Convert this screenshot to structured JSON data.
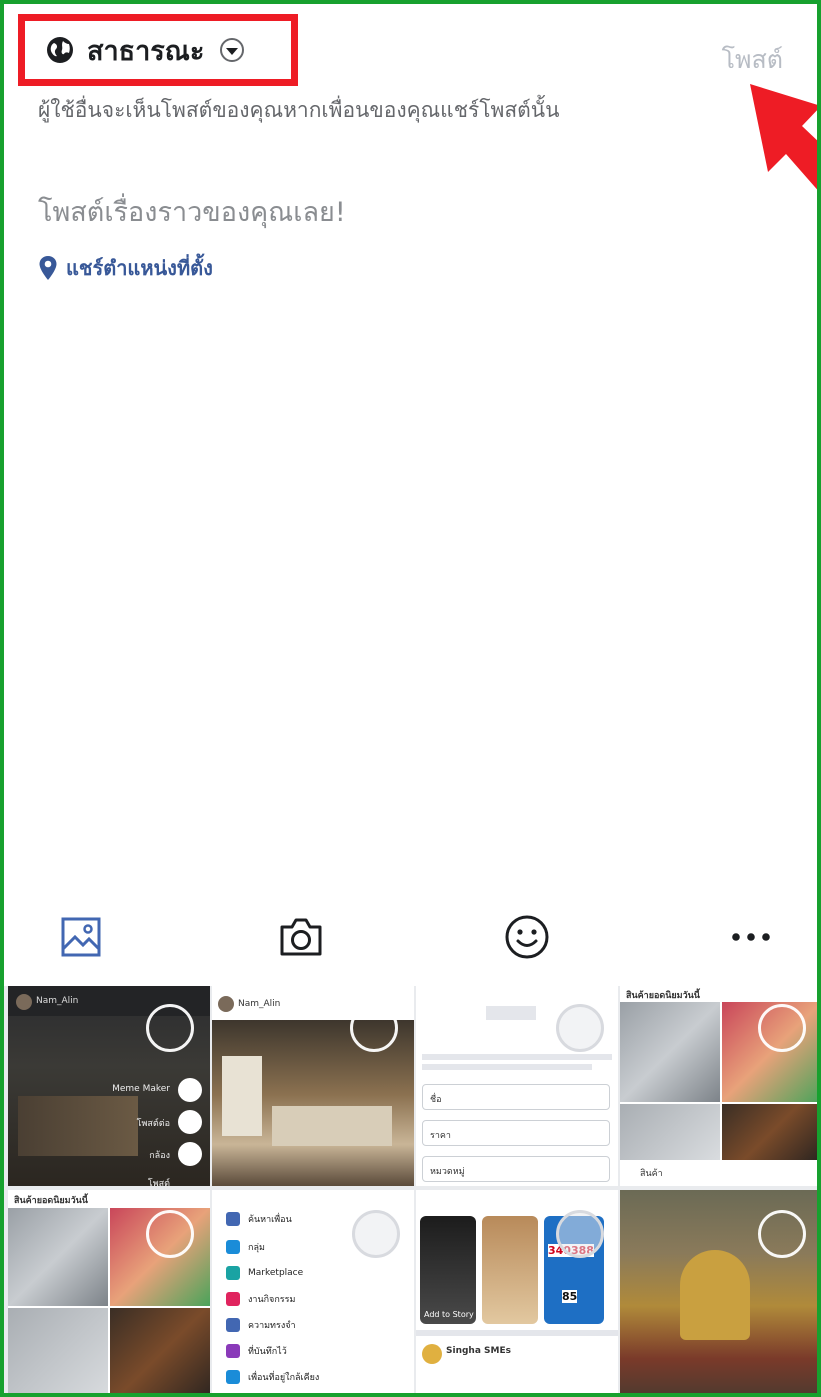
{
  "header": {
    "audience_label": "สาธารณะ",
    "post_button": "โพสต์",
    "subtitle": "ผู้ใช้อื่นจะเห็นโพสต์ของคุณหากเพื่อนของคุณแชร์โพสต์นั้น"
  },
  "composer": {
    "placeholder": "โพสต์เรื่องราวของคุณเลย!",
    "location_label": "แชร์ตำแหน่งที่ตั้ง"
  },
  "toolbar": {
    "icons": [
      "photo-icon",
      "camera-icon",
      "emoji-icon",
      "more-icon"
    ]
  },
  "gallery": {
    "thumb1": {
      "user": "Nam_Alin",
      "menu": [
        "Meme Maker",
        "โพสต์ต่อ",
        "กล้อง",
        "โพสต์"
      ]
    },
    "thumb2": {
      "user": "Nam_Alin"
    },
    "thumb3": {
      "fields": [
        "ชื่อ",
        "ราคา",
        "หมวดหมู่"
      ]
    },
    "thumb4": {
      "title": "สินค้ายอดนิยมวันนี้",
      "tag": "สินค้า"
    },
    "thumb5": {
      "title": "สินค้ายอดนิยมวันนี้"
    },
    "thumb6": {
      "menu": [
        "ค้นหาเพื่อน",
        "กลุ่ม",
        "Marketplace",
        "งานกิจกรรม",
        "ความทรงจำ",
        "ที่บันทึกไว้",
        "เพื่อนที่อยู่ใกล้เคียง"
      ]
    },
    "thumb7": {
      "story_label": "Add to Story",
      "page_name": "Singha SMEs",
      "numbers": [
        "340388",
        "85"
      ]
    }
  },
  "colors": {
    "frame_border": "#17a12e",
    "highlight": "#ee1c25",
    "link": "#385898",
    "icon_blue": "#4267b2"
  }
}
